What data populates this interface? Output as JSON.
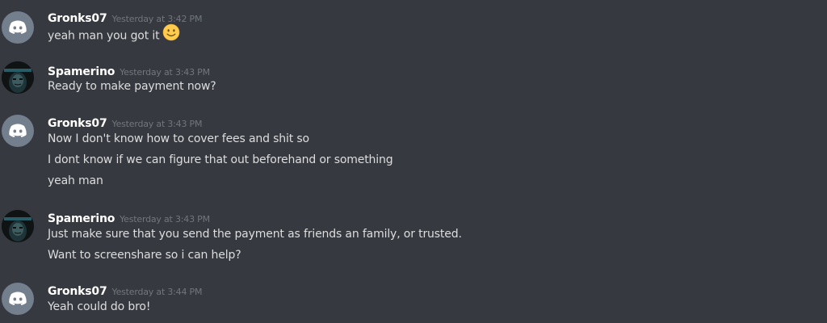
{
  "messages": [
    {
      "username": "Gronks07",
      "timestamp": "Yesterday at 3:42 PM",
      "avatar": "discord-default-avatar",
      "lines": [
        "yeah man you got it"
      ],
      "emoji": "slightly-smiling-face-emoji"
    },
    {
      "username": "Spamerino",
      "timestamp": "Yesterday at 3:43 PM",
      "avatar": "dark-custom-avatar",
      "lines": [
        "Ready to make payment now?"
      ]
    },
    {
      "username": "Gronks07",
      "timestamp": "Yesterday at 3:43 PM",
      "avatar": "discord-default-avatar",
      "lines": [
        "Now I don't know how to cover fees and shit so",
        "I dont know if we can figure that out beforehand or something",
        "yeah man"
      ]
    },
    {
      "username": "Spamerino",
      "timestamp": "Yesterday at 3:43 PM",
      "avatar": "dark-custom-avatar",
      "lines": [
        "Just make sure that you send the payment as friends an family, or trusted.",
        "Want to screenshare so i can help?"
      ]
    },
    {
      "username": "Gronks07",
      "timestamp": "Yesterday at 3:44 PM",
      "avatar": "discord-default-avatar",
      "lines": [
        "Yeah could do bro!"
      ]
    }
  ],
  "colors": {
    "background": "#36393f",
    "username": "#ffffff",
    "timestamp": "#72767d",
    "text": "#dcddde",
    "default_avatar": "#747f8d"
  }
}
